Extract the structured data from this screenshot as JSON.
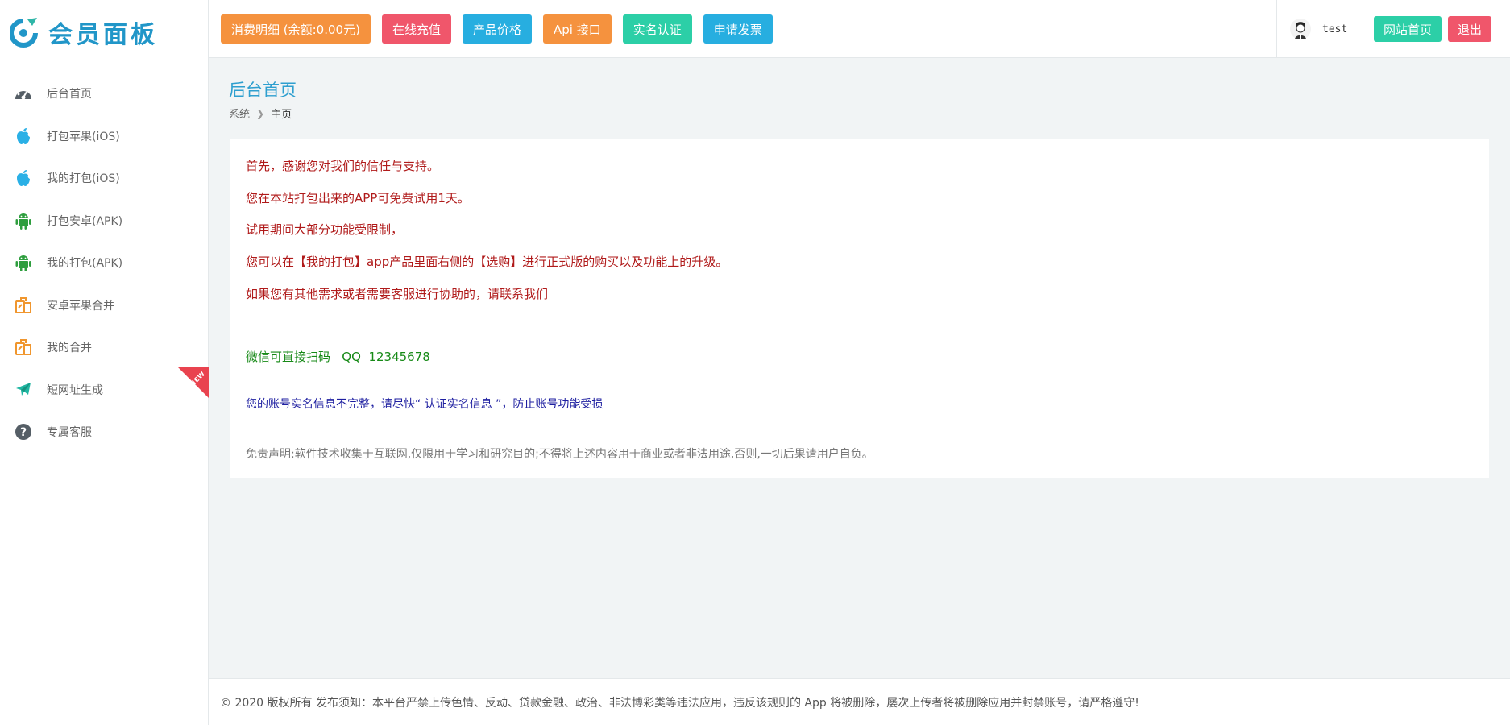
{
  "app": {
    "logo_text": "会员面板"
  },
  "sidebar": {
    "items": [
      {
        "label": "后台首页",
        "icon": "dashboard-icon",
        "color": "#555e66"
      },
      {
        "label": "打包苹果(iOS)",
        "icon": "apple-icon",
        "color": "#2ab0e6"
      },
      {
        "label": "我的打包(iOS)",
        "icon": "apple-icon",
        "color": "#2ab0e6"
      },
      {
        "label": "打包安卓(APK)",
        "icon": "android-icon",
        "color": "#2e9e3e"
      },
      {
        "label": "我的打包(APK)",
        "icon": "android-icon",
        "color": "#2e9e3e"
      },
      {
        "label": "安卓苹果合并",
        "icon": "copy-icon",
        "color": "#f0962e"
      },
      {
        "label": "我的合并",
        "icon": "copy-icon",
        "color": "#f0962e"
      },
      {
        "label": "短网址生成",
        "icon": "plane-icon",
        "color": "#1fb6a2",
        "badge": "NEW"
      },
      {
        "label": "专属客服",
        "icon": "question-icon",
        "color": "#555e66"
      }
    ]
  },
  "header": {
    "buttons": [
      {
        "label": "消费明细 (余额:0.00元)",
        "color": "#f5923e"
      },
      {
        "label": "在线充值",
        "color": "#f0566b"
      },
      {
        "label": "产品价格",
        "color": "#27aee0"
      },
      {
        "label": "Api 接口",
        "color": "#f5923e"
      },
      {
        "label": "实名认证",
        "color": "#2ccfa7"
      },
      {
        "label": "申请发票",
        "color": "#27aee0"
      }
    ],
    "username": "test",
    "site_home_label": "网站首页",
    "site_home_color": "#2ccfa7",
    "logout_label": "退出",
    "logout_color": "#f0566b"
  },
  "main": {
    "page_title": "后台首页",
    "breadcrumb": [
      "系统",
      "主页"
    ],
    "messages": [
      "首先，感谢您对我们的信任与支持。",
      "您在本站打包出来的APP可免费试用1天。",
      "试用期间大部分功能受限制，",
      "您可以在【我的打包】app产品里面右侧的【选购】进行正式版的购买以及功能上的升级。",
      "如果您有其他需求或者需要客服进行协助的，请联系我们"
    ],
    "contact": "微信可直接扫码   QQ  12345678",
    "warning": "您的账号实名信息不完整，请尽快“ 认证实名信息 ”，防止账号功能受损",
    "disclaimer": "免责声明:软件技术收集于互联网,仅限用于学习和研究目的;不得将上述内容用于商业或者非法用途,否则,一切后果请用户自负。"
  },
  "footer": {
    "text": "© 2020 版权所有 发布须知：本平台严禁上传色情、反动、贷款金融、政治、非法博彩类等违法应用，违反该规则的 App 将被删除，屡次上传者将被删除应用并封禁账号，请严格遵守!"
  }
}
